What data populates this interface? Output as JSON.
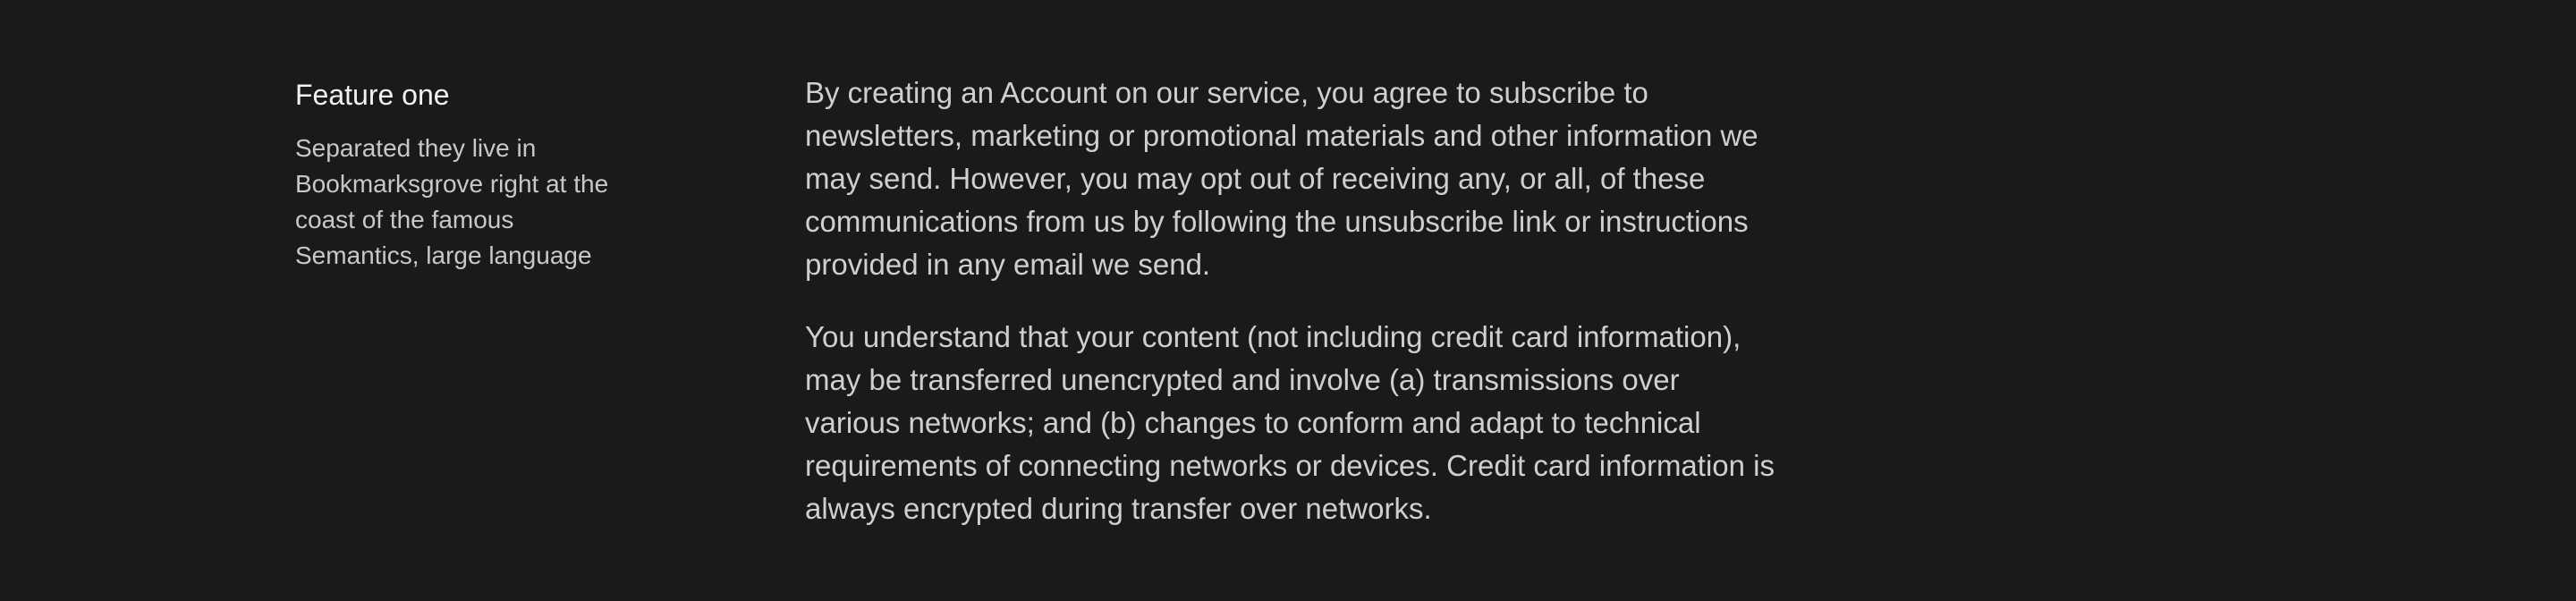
{
  "feature": {
    "title": "Feature one",
    "description": "Separated they live in Bookmarksgrove right at the coast of the famous Semantics, large language"
  },
  "legal": {
    "paragraphs": [
      "By creating an Account on our service, you agree to subscribe to newsletters, marketing or promotional materials and other information we may send. However, you may opt out of receiving any, or all, of these communications from us by following the unsubscribe link or instructions provided in any email we send.",
      "You understand that your content (not including credit card information), may be transferred unencrypted and involve (a) transmissions over various networks; and (b) changes to conform and adapt to technical requirements of connecting networks or devices. Credit card information is always encrypted during transfer over networks."
    ]
  },
  "colors": {
    "background": "#1a1a1a",
    "heading": "#f2f2f2",
    "body_text": "#cfcfcf"
  }
}
